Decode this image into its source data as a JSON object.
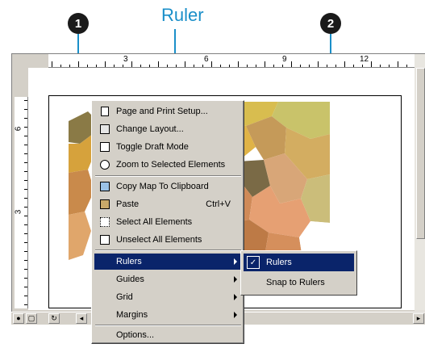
{
  "caption": {
    "ruler_label": "Ruler",
    "callout_1": "1",
    "callout_2": "2"
  },
  "ruler_horizontal": {
    "marks": [
      "3",
      "6",
      "9",
      "12"
    ]
  },
  "ruler_vertical": {
    "marks": [
      "6",
      "3"
    ]
  },
  "context_menu": {
    "items": [
      {
        "label": "Page and Print Setup...",
        "icon": "page-setup-icon"
      },
      {
        "label": "Change Layout...",
        "icon": "change-layout-icon"
      },
      {
        "label": "Toggle Draft Mode",
        "icon": "draft-mode-icon"
      },
      {
        "label": "Zoom to Selected Elements",
        "icon": "zoom-selected-icon"
      },
      {
        "label": "Copy Map To Clipboard",
        "icon": "copy-map-icon"
      },
      {
        "label": "Paste",
        "shortcut": "Ctrl+V",
        "icon": "paste-icon"
      },
      {
        "label": "Select All Elements",
        "icon": "select-all-icon"
      },
      {
        "label": "Unselect All Elements",
        "icon": "unselect-all-icon"
      },
      {
        "label": "Rulers"
      },
      {
        "label": "Guides"
      },
      {
        "label": "Grid"
      },
      {
        "label": "Margins"
      },
      {
        "label": "Options..."
      }
    ]
  },
  "submenu": {
    "items": [
      {
        "label": "Rulers",
        "icon": "rulers-check-icon"
      },
      {
        "label": "Snap to Rulers"
      }
    ]
  },
  "colors": {
    "accent": "#1a8fc9",
    "menu_highlight": "#0a246a",
    "menu_bg": "#d4d0c8"
  }
}
